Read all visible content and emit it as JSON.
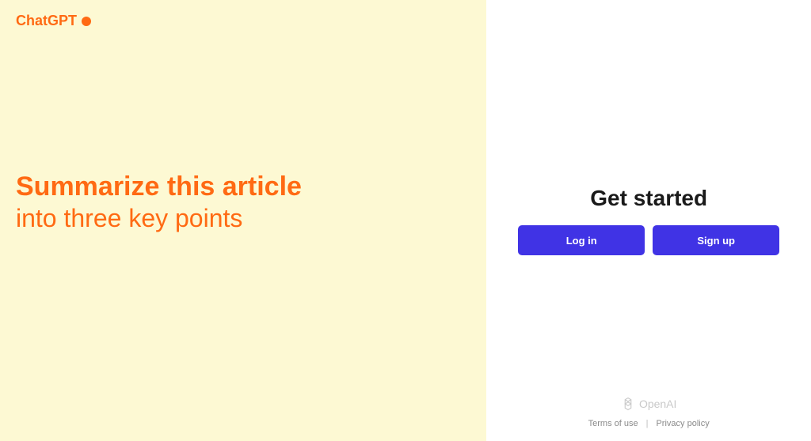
{
  "brand": {
    "name": "ChatGPT"
  },
  "prompt": {
    "line1": "Summarize this article",
    "line2": "into three key points"
  },
  "right": {
    "heading": "Get started",
    "login_label": "Log in",
    "signup_label": "Sign up"
  },
  "footer": {
    "company": "OpenAI",
    "terms": "Terms of use",
    "privacy": "Privacy policy"
  }
}
